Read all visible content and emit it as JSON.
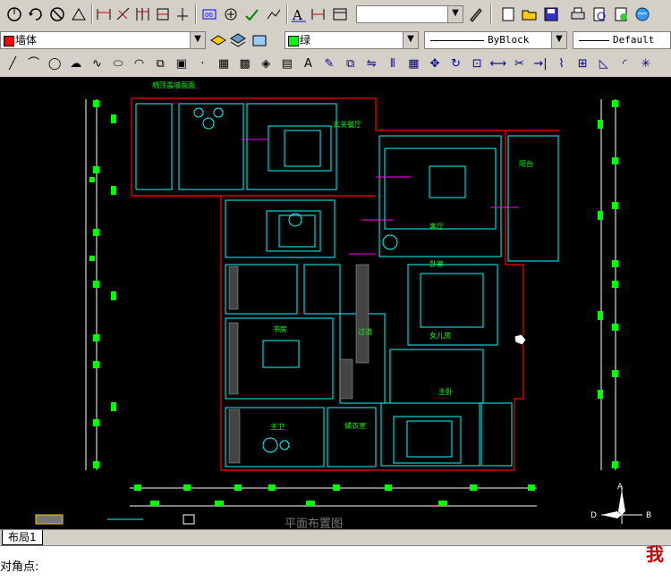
{
  "toolbar1": {
    "icons": [
      "snap-icon",
      "rotate-icon",
      "no-icon",
      "arrow-up-icon",
      "dim-linear-icon",
      "dim-aligned-icon",
      "dim-baseline-icon",
      "dim-continue-icon",
      "dim-ordinate-icon",
      "dim-quick-icon",
      "dim-center-icon",
      "dim-tolerance-icon",
      "dim-leader-icon",
      "text-style-icon",
      "dim-style-icon",
      "new-icon",
      "open-icon",
      "save-icon",
      "print-icon",
      "preview-icon",
      "publish-icon",
      "plot-icon"
    ],
    "text_style_combo": ""
  },
  "toolbar2": {
    "layer_name": "墙体",
    "layer_color": "#ff0000",
    "color_name": "绿",
    "color_swatch": "#00ff00",
    "linetype": "ByBlock",
    "lineweight": "Default"
  },
  "toolbar3": {
    "icons": [
      "line-icon",
      "arc-icon",
      "circle-icon",
      "cloud-icon",
      "spline-icon",
      "ellipse-icon",
      "ellipse-arc-icon",
      "insert-icon",
      "block-icon",
      "point-icon",
      "hatch-icon",
      "gradient-icon",
      "region-icon",
      "table-icon",
      "mtext-icon",
      "erase-icon",
      "copy-icon",
      "mirror-icon",
      "offset-icon",
      "array-icon",
      "move-icon",
      "rotate-icon",
      "scale-icon",
      "stretch-icon",
      "trim-icon",
      "extend-icon",
      "break-icon",
      "join-icon",
      "chamfer-icon",
      "fillet-icon",
      "explode-icon"
    ]
  },
  "drawing": {
    "title": "平面布置图",
    "rooms": [
      "玄关餐厅",
      "客厅",
      "卧室",
      "书房",
      "过道",
      "女儿房",
      "主卧",
      "主卫",
      "储衣室",
      "阳台"
    ],
    "compass": {
      "d": "D",
      "b": "B",
      "a": "A"
    },
    "note_top": "机顶盖墙面面"
  },
  "tabs": [
    {
      "label": "布局1"
    }
  ],
  "command_line": "对角点:",
  "watermark": "我"
}
